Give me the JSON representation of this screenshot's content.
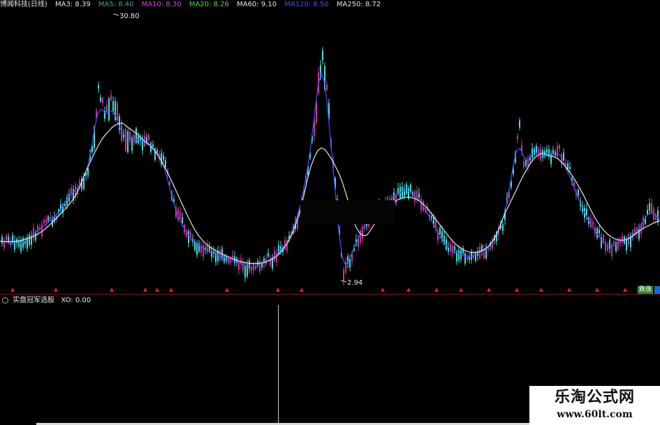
{
  "header": {
    "stock_name": "博闻科技(日线)",
    "indicators": [
      {
        "label": "MA3: 8.39",
        "color": "#e6e6e6"
      },
      {
        "label": "MA5: 8.40",
        "color": "#2fa89a"
      },
      {
        "label": "MA10: 8.30",
        "color": "#e040e0"
      },
      {
        "label": "MA20: 8.26",
        "color": "#44dd44"
      },
      {
        "label": "MA60: 9.10",
        "color": "#e6e6e6"
      },
      {
        "label": "MA120: 8.50",
        "color": "#3f4fff"
      },
      {
        "label": "MA250: 8.72",
        "color": "#e6e6e6"
      }
    ]
  },
  "price_chart": {
    "high_label": "30.80",
    "low_label": "2.94",
    "colors": {
      "up": "#cc3399",
      "down": "#44dddd",
      "ma": "#e6e6e6",
      "ma_blue": "#3f4fff",
      "signal": "#e02020"
    }
  },
  "sub_panel": {
    "title": "实盘冠军选股",
    "value": "XO: 0.00"
  },
  "corner_badge": "跌涨",
  "watermark": {
    "title": "乐淘公式网",
    "url": "www.60lt.com"
  }
}
